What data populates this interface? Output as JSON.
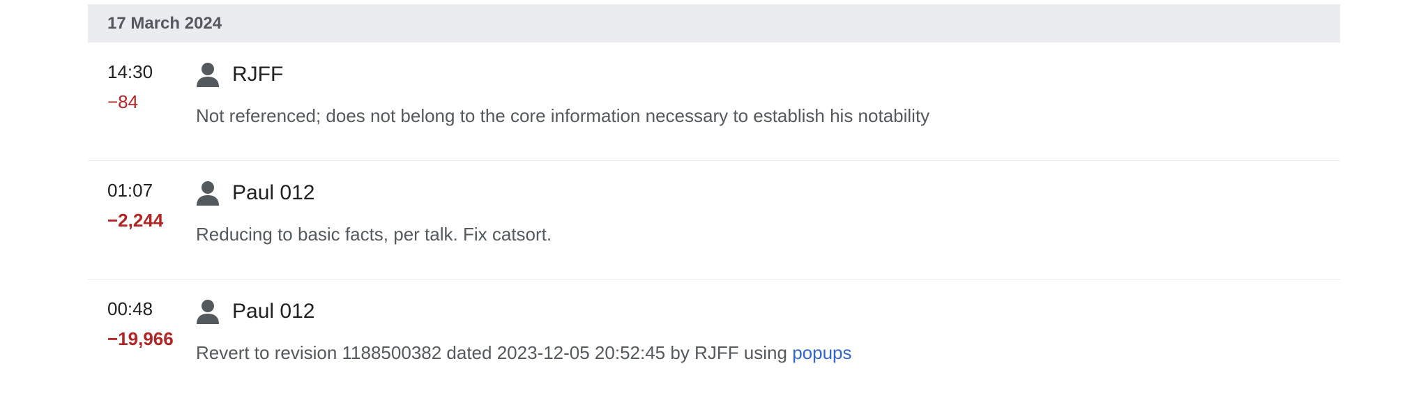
{
  "history": {
    "date": "17 March 2024",
    "entries": [
      {
        "time": "14:30",
        "size_change": "−84",
        "user": "RJFF",
        "summary": "Not referenced; does not belong to the core information necessary to establish his notability"
      },
      {
        "time": "01:07",
        "size_change": "−2,244",
        "user": "Paul 012",
        "summary": "Reducing to basic facts, per talk. Fix catsort."
      },
      {
        "time": "00:48",
        "size_change": "−19,966",
        "user": "Paul 012",
        "summary": "Revert to revision 1188500382 dated 2023-12-05 20:52:45 by RJFF using ",
        "summary_link": "popups"
      }
    ]
  },
  "colors": {
    "header_bg": "#eaecf0",
    "negative_change": "#b32424",
    "link": "#3366cc",
    "icon": "#54595d"
  },
  "icons": {
    "user": "user-avatar-icon"
  }
}
